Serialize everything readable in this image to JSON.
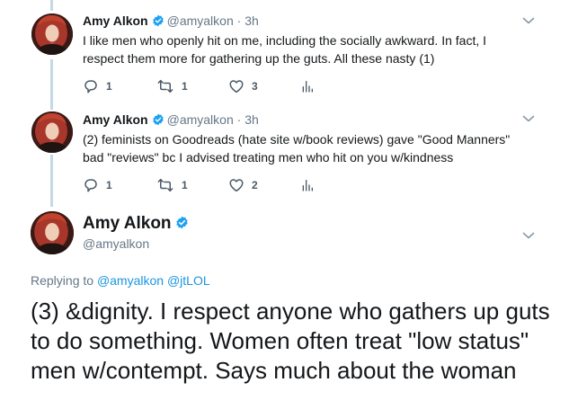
{
  "tweets": [
    {
      "name": "Amy Alkon",
      "handle": "@amyalkon",
      "separator": "·",
      "time": "3h",
      "lines": [
        "I like men who openly hit on me, including the socially awkward. In fact, I",
        "respect them more for gathering up the guts. All these nasty (1)"
      ],
      "reply_count": "1",
      "retweet_count": "1",
      "like_count": "3"
    },
    {
      "name": "Amy Alkon",
      "handle": "@amyalkon",
      "separator": "·",
      "time": "3h",
      "lines": [
        "(2) feminists on Goodreads (hate site w/book reviews) gave \"Good Manners\"",
        "bad \"reviews\" bc I advised treating men who hit on you w/kindness"
      ],
      "reply_count": "1",
      "retweet_count": "1",
      "like_count": "2"
    }
  ],
  "main_tweet": {
    "name": "Amy Alkon",
    "handle": "@amyalkon",
    "replying_prefix": "Replying to",
    "replying_to_1": "@amyalkon",
    "replying_to_2": "@jtLOL",
    "text": "(3) &dignity. I respect anyone who gathers up guts to do something. Women often treat \"low status\" men w/contempt. Says much about the woman"
  },
  "colors": {
    "verified": "#1da1f2",
    "thread_line": "#c4d8e6",
    "muted": "#657786",
    "link": "#1b95e0"
  },
  "icons": [
    "verified-badge-icon",
    "reply-icon",
    "retweet-icon",
    "like-icon",
    "analytics-icon",
    "chevron-down-icon"
  ]
}
